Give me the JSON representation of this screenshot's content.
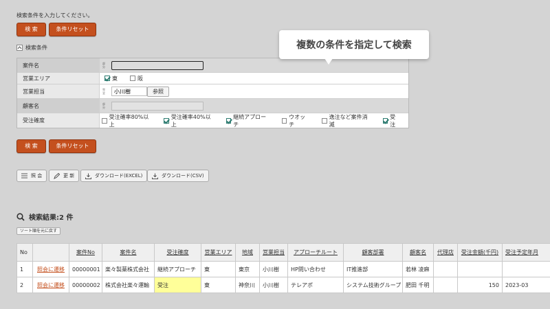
{
  "instruction": "検索条件を入力してください。",
  "buttons": {
    "search": "検 索",
    "reset": "条件リセット"
  },
  "condition_section": {
    "title": "検索条件"
  },
  "conditions": {
    "case_name": {
      "label": "案件名",
      "hint": "部分"
    },
    "sales_area": {
      "label": "営業エリア",
      "options": [
        {
          "label": "東",
          "checked": true
        },
        {
          "label": "阪",
          "checked": false
        }
      ]
    },
    "sales_person": {
      "label": "営業担当",
      "hint": "完全",
      "value": "小川樹",
      "browse": "参照"
    },
    "customer_name": {
      "label": "顧客名",
      "hint": "部分"
    },
    "order_certainty": {
      "label": "受注確度",
      "options": [
        {
          "label": "受注確率80%以上",
          "checked": false
        },
        {
          "label": "受注確率40%以上",
          "checked": true
        },
        {
          "label": "継続アプローチ",
          "checked": true
        },
        {
          "label": "ウオッチ",
          "checked": false
        },
        {
          "label": "逸注など案件消滅",
          "checked": false
        },
        {
          "label": "受注",
          "checked": true
        }
      ]
    }
  },
  "tooltip": "複数の条件を指定して検索",
  "toolbar": {
    "view": "照 会",
    "update": "更 新",
    "download_excel": "ダウンロード(EXCEL)",
    "download_csv": "ダウンロード(CSV)"
  },
  "results": {
    "title": "検索結果:2 件",
    "reset_sort": "ソート順を元に戻す",
    "columns": [
      "No",
      "",
      "案件No",
      "案件名",
      "受注確度",
      "営業エリア",
      "地域",
      "営業担当",
      "アプローチルート",
      "顧客部署",
      "顧客名",
      "代理店",
      "受注金額(千円)",
      "受注予定年月"
    ],
    "rows": [
      [
        "1",
        "照会に遷移",
        "00000001",
        "楽々製薬株式会社",
        "継続アプローチ",
        "東",
        "東京",
        "小川樹",
        "HP問い合わせ",
        "IT推進部",
        "若林 凌麻",
        "",
        "",
        ""
      ],
      [
        "2",
        "照会に遷移",
        "00000002",
        "株式会社楽々運輸",
        "受注",
        "東",
        "神奈川",
        "小川樹",
        "テレアポ",
        "システム技術グループ",
        "肥田 千明",
        "",
        "150",
        "2023-03"
      ]
    ]
  },
  "colors": {
    "accent": "#c4501e",
    "highlight": "#ffff99"
  }
}
